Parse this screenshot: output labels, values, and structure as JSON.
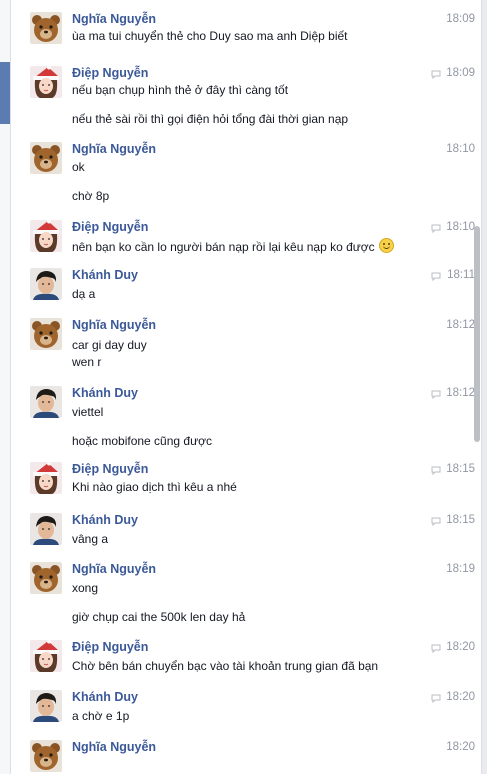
{
  "messages": [
    {
      "sender": "Nghĩa Nguyễn",
      "avatar": "teddy-bear",
      "time": "18:09",
      "lines": [
        "ùa ma tui chuyển thẻ cho Duy sao ma anh Diệp biết"
      ]
    },
    {
      "sender": "Điệp Nguyễn",
      "avatar": "girl-santa-hat",
      "time": "18:09",
      "seen": true,
      "lines": [
        "nếu bạn chụp hình thẻ ở đây thì càng tốt",
        "nếu thẻ sài rồi thì gọi điện hỏi tổng đài thời gian nạp"
      ]
    },
    {
      "sender": "Nghĩa Nguyễn",
      "avatar": "teddy-bear",
      "time": "18:10",
      "lines": [
        "ok",
        "chờ 8p"
      ]
    },
    {
      "sender": "Điệp Nguyễn",
      "avatar": "girl-santa-hat",
      "time": "18:10",
      "seen": true,
      "lines": [
        "nên bạn ko cần lo người bán nạp rồi lại kêu nạp ko được"
      ],
      "emoji": "smile"
    },
    {
      "sender": "Khánh Duy",
      "avatar": "young-man",
      "time": "18:11",
      "seen": true,
      "lines": [
        "dạ a"
      ]
    },
    {
      "sender": "Nghĩa Nguyễn",
      "avatar": "teddy-bear",
      "time": "18:12",
      "lines": [
        "car gi day duy",
        "wen r"
      ]
    },
    {
      "sender": "Khánh Duy",
      "avatar": "young-man",
      "time": "18:12",
      "seen": true,
      "lines": [
        "viettel",
        "hoặc mobifone cũng được"
      ]
    },
    {
      "sender": "Điệp Nguyễn",
      "avatar": "girl-santa-hat",
      "time": "18:15",
      "seen": true,
      "lines": [
        "Khi nào giao dịch thì kêu a nhé"
      ]
    },
    {
      "sender": "Khánh Duy",
      "avatar": "young-man",
      "time": "18:15",
      "seen": true,
      "lines": [
        "vâng a"
      ]
    },
    {
      "sender": "Nghĩa Nguyễn",
      "avatar": "teddy-bear",
      "time": "18:19",
      "lines": [
        "xong",
        "giờ chụp cai the 500k len day hả"
      ]
    },
    {
      "sender": "Điệp Nguyễn",
      "avatar": "girl-santa-hat",
      "time": "18:20",
      "seen": true,
      "lines": [
        "Chờ bên bán chuyển bạc vào tài khoản trung gian đã bạn"
      ]
    },
    {
      "sender": "Khánh Duy",
      "avatar": "young-man",
      "time": "18:20",
      "seen": true,
      "lines": [
        "a chờ e 1p"
      ]
    },
    {
      "sender": "Nghĩa Nguyễn",
      "avatar": "teddy-bear",
      "time": "18:20",
      "lines": []
    }
  ]
}
